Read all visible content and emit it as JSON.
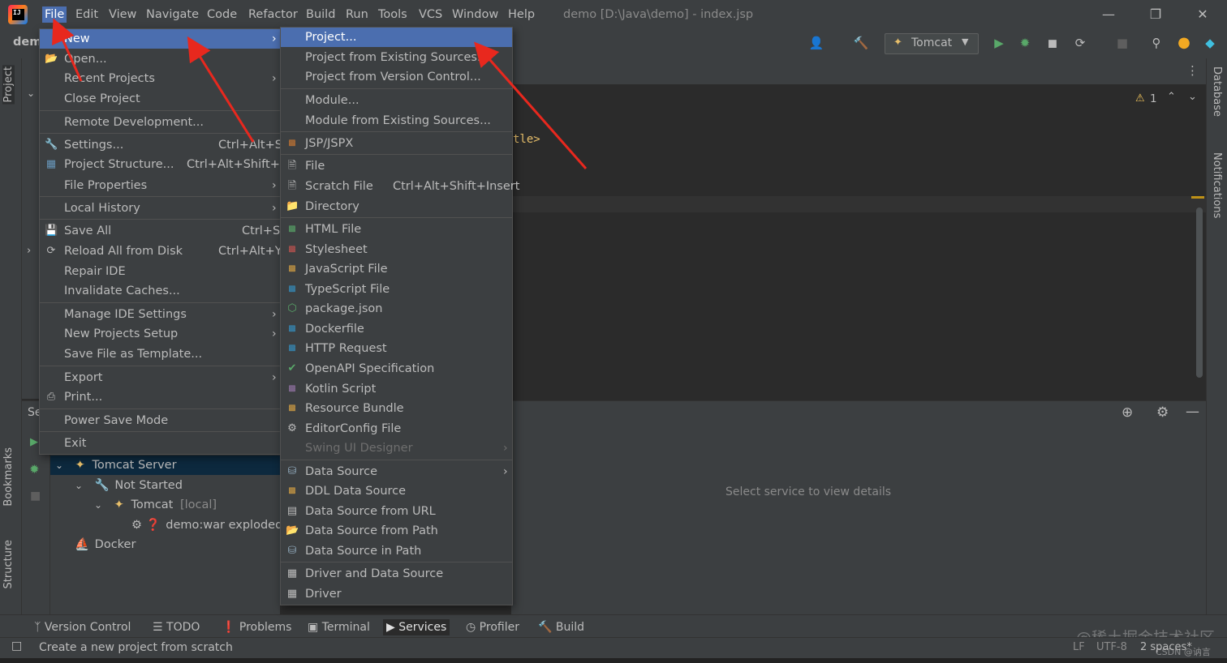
{
  "menubar": {
    "items": [
      "File",
      "Edit",
      "View",
      "Navigate",
      "Code",
      "Refactor",
      "Build",
      "Run",
      "Tools",
      "VCS",
      "Window",
      "Help"
    ],
    "window_title": "demo [D:\\Java\\demo] - index.jsp",
    "logo_text": "IJ"
  },
  "toolbar": {
    "project_name": "demo",
    "run_config": "Tomcat"
  },
  "side_tabs": {
    "project": "Project",
    "bookmarks": "Bookmarks",
    "structure": "Structure",
    "database": "Database",
    "notifications": "Notifications"
  },
  "editor": {
    "code_fragment": "tle>",
    "warning_count": "1"
  },
  "services": {
    "header_fragment": "Se",
    "placeholder": "Select service to view details",
    "tree": [
      {
        "label": "Tomcat Server",
        "extra": ""
      },
      {
        "label": "Not Started",
        "extra": ""
      },
      {
        "label": "Tomcat",
        "extra": "[local]"
      },
      {
        "label": "demo:war exploded",
        "extra": ""
      },
      {
        "label": "Docker",
        "extra": ""
      }
    ]
  },
  "file_menu": {
    "items": [
      {
        "label": "New",
        "shortcut": "",
        "submenu": true
      },
      {
        "label": "Open...",
        "shortcut": "",
        "submenu": false
      },
      {
        "label": "Recent Projects",
        "shortcut": "",
        "submenu": true
      },
      {
        "label": "Close Project",
        "shortcut": "",
        "submenu": false
      },
      {
        "label": "Remote Development...",
        "shortcut": "",
        "submenu": false
      },
      {
        "label": "Settings...",
        "shortcut": "Ctrl+Alt+S",
        "submenu": false
      },
      {
        "label": "Project Structure...",
        "shortcut": "Ctrl+Alt+Shift+S",
        "submenu": false
      },
      {
        "label": "File Properties",
        "shortcut": "",
        "submenu": true
      },
      {
        "label": "Local History",
        "shortcut": "",
        "submenu": true
      },
      {
        "label": "Save All",
        "shortcut": "Ctrl+S",
        "submenu": false
      },
      {
        "label": "Reload All from Disk",
        "shortcut": "Ctrl+Alt+Y",
        "submenu": false
      },
      {
        "label": "Repair IDE",
        "shortcut": "",
        "submenu": false
      },
      {
        "label": "Invalidate Caches...",
        "shortcut": "",
        "submenu": false
      },
      {
        "label": "Manage IDE Settings",
        "shortcut": "",
        "submenu": true
      },
      {
        "label": "New Projects Setup",
        "shortcut": "",
        "submenu": true
      },
      {
        "label": "Save File as Template...",
        "shortcut": "",
        "submenu": false
      },
      {
        "label": "Export",
        "shortcut": "",
        "submenu": true
      },
      {
        "label": "Print...",
        "shortcut": "",
        "submenu": false
      },
      {
        "label": "Power Save Mode",
        "shortcut": "",
        "submenu": false
      },
      {
        "label": "Exit",
        "shortcut": "",
        "submenu": false
      }
    ]
  },
  "new_menu": {
    "items": [
      {
        "label": "Project...",
        "shortcut": "",
        "submenu": false
      },
      {
        "label": "Project from Existing Sources...",
        "shortcut": "",
        "submenu": false
      },
      {
        "label": "Project from Version Control...",
        "shortcut": "",
        "submenu": false
      },
      {
        "label": "Module...",
        "shortcut": "",
        "submenu": false
      },
      {
        "label": "Module from Existing Sources...",
        "shortcut": "",
        "submenu": false
      },
      {
        "label": "JSP/JSPX",
        "shortcut": "",
        "submenu": false
      },
      {
        "label": "File",
        "shortcut": "",
        "submenu": false
      },
      {
        "label": "Scratch File",
        "shortcut": "Ctrl+Alt+Shift+Insert",
        "submenu": false
      },
      {
        "label": "Directory",
        "shortcut": "",
        "submenu": false
      },
      {
        "label": "HTML File",
        "shortcut": "",
        "submenu": false
      },
      {
        "label": "Stylesheet",
        "shortcut": "",
        "submenu": false
      },
      {
        "label": "JavaScript File",
        "shortcut": "",
        "submenu": false
      },
      {
        "label": "TypeScript File",
        "shortcut": "",
        "submenu": false
      },
      {
        "label": "package.json",
        "shortcut": "",
        "submenu": false
      },
      {
        "label": "Dockerfile",
        "shortcut": "",
        "submenu": false
      },
      {
        "label": "HTTP Request",
        "shortcut": "",
        "submenu": false
      },
      {
        "label": "OpenAPI Specification",
        "shortcut": "",
        "submenu": false
      },
      {
        "label": "Kotlin Script",
        "shortcut": "",
        "submenu": false
      },
      {
        "label": "Resource Bundle",
        "shortcut": "",
        "submenu": false
      },
      {
        "label": "EditorConfig File",
        "shortcut": "",
        "submenu": false
      },
      {
        "label": "Swing UI Designer",
        "shortcut": "",
        "submenu": true
      },
      {
        "label": "Data Source",
        "shortcut": "",
        "submenu": true
      },
      {
        "label": "DDL Data Source",
        "shortcut": "",
        "submenu": false
      },
      {
        "label": "Data Source from URL",
        "shortcut": "",
        "submenu": false
      },
      {
        "label": "Data Source from Path",
        "shortcut": "",
        "submenu": false
      },
      {
        "label": "Data Source in Path",
        "shortcut": "",
        "submenu": false
      },
      {
        "label": "Driver and Data Source",
        "shortcut": "",
        "submenu": false
      },
      {
        "label": "Driver",
        "shortcut": "",
        "submenu": false
      }
    ]
  },
  "bottom_tabs": [
    "Version Control",
    "TODO",
    "Problems",
    "Terminal",
    "Services",
    "Profiler",
    "Build"
  ],
  "status": {
    "message": "Create a new project from scratch",
    "line_sep": "LF",
    "encoding": "UTF-8",
    "indent": "2 spaces*"
  },
  "watermark": {
    "main": "@稀土掘金技术社区",
    "small": "CSDN @讷言"
  },
  "colors": {
    "selection": "#4b6eaf",
    "annotation_arrow": "#e8281e"
  }
}
